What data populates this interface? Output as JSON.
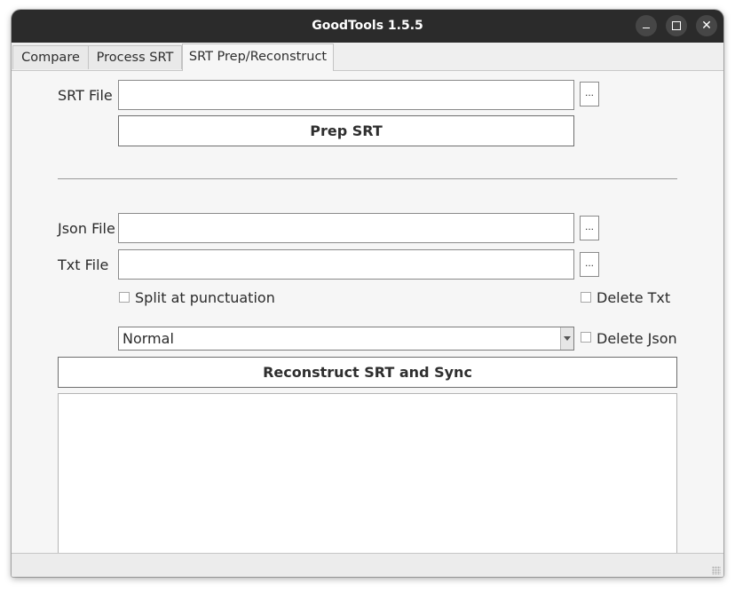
{
  "window": {
    "title": "GoodTools 1.5.5",
    "controls": {
      "minimize_icon": "minimize-icon",
      "maximize_icon": "maximize-icon",
      "close_icon": "close-icon",
      "close_glyph": "✕"
    }
  },
  "tabs": [
    {
      "label": "Compare",
      "active": false
    },
    {
      "label": "Process SRT",
      "active": false
    },
    {
      "label": "SRT Prep/Reconstruct",
      "active": true
    }
  ],
  "prep": {
    "srt_label": "SRT File",
    "srt_value": "",
    "browse_label": "...",
    "prep_button": "Prep SRT"
  },
  "reconstruct": {
    "json_label": "Json File",
    "json_value": "",
    "txt_label": "Txt File",
    "txt_value": "",
    "browse_label": "...",
    "split_label": "Split at punctuation",
    "split_checked": false,
    "delete_txt_label": "Delete Txt",
    "delete_txt_checked": false,
    "delete_json_label": "Delete Json",
    "delete_json_checked": false,
    "mode_selected": "Normal",
    "reconstruct_button": "Reconstruct SRT and Sync",
    "log_text": ""
  },
  "colors": {
    "titlebar": "#2b2b2b",
    "window_bg": "#f6f6f6"
  }
}
